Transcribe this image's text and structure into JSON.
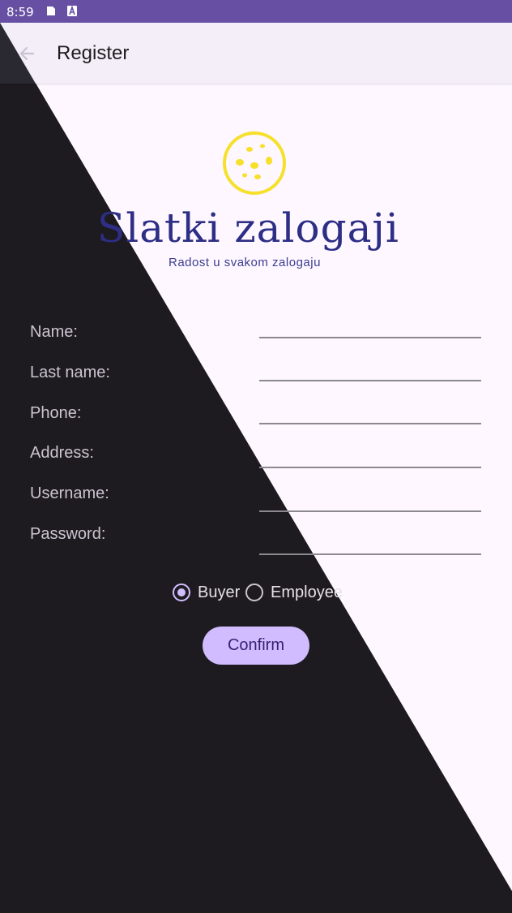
{
  "status_bar": {
    "time": "8:59",
    "icons": [
      "document-icon",
      "text-a-icon"
    ]
  },
  "app_bar": {
    "title": "Register",
    "back_icon": "arrow-back-icon"
  },
  "logo": {
    "name": "Slatki zalogaji",
    "tagline": "Radost u svakom zalogaju",
    "icon": "cookie-icon"
  },
  "form": {
    "fields": [
      {
        "label": "Name:",
        "value": "",
        "placeholder": ""
      },
      {
        "label": "Last name:",
        "value": "",
        "placeholder": ""
      },
      {
        "label": "Phone:",
        "value": "",
        "placeholder": ""
      },
      {
        "label": "Address:",
        "value": "",
        "placeholder": ""
      },
      {
        "label": "Username:",
        "value": "",
        "placeholder": ""
      },
      {
        "label": "Password:",
        "value": "",
        "placeholder": ""
      }
    ],
    "role_options": [
      {
        "label": "Buyer",
        "selected": true
      },
      {
        "label": "Employee",
        "selected": false
      }
    ],
    "confirm_label": "Confirm"
  },
  "colors": {
    "status_bar": "#6750a4",
    "background_light": "#fef7ff",
    "background_dark": "#1d1b20",
    "accent": "#d0bcff",
    "brand_text": "#2d2e85",
    "cookie_yellow": "#f6e02a"
  }
}
